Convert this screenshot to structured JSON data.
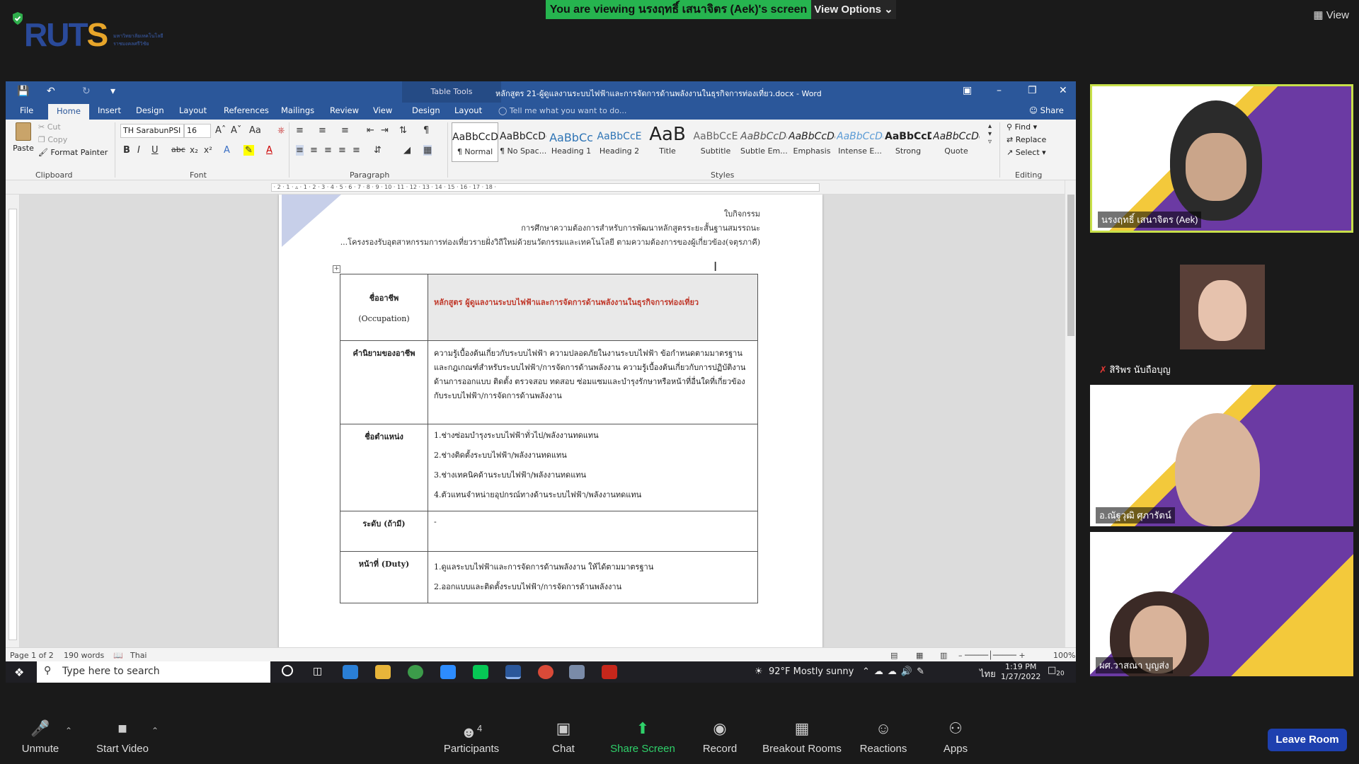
{
  "zoom": {
    "banner": "You are viewing นรงฤทธิ์ เสนาจิตร (Aek)'s screen",
    "view_options": "View Options ⌄",
    "view_top": "View",
    "logo": {
      "text_main": "RUT",
      "text_accent": "S",
      "sub": "มหาวิทยาลัยเทคโนโลยีราชมงคลศรีวิชัย"
    },
    "toolbar": {
      "unmute": "Unmute",
      "start_video": "Start Video",
      "participants": "Participants",
      "participants_count": "4",
      "chat": "Chat",
      "share_screen": "Share Screen",
      "record": "Record",
      "breakout_rooms": "Breakout Rooms",
      "reactions": "Reactions",
      "apps": "Apps",
      "leave": "Leave Room"
    },
    "participants": [
      {
        "name": "นรงฤทธิ์ เสนาจิตร (Aek)"
      },
      {
        "name": "สิริพร นับถือบุญ"
      },
      {
        "name": "อ.ณัฐวุฒิ ศุภารัตน์"
      },
      {
        "name": "ผศ.วาสณา บุญส่ง"
      }
    ],
    "colors": {
      "banner_green": "#26b44f",
      "leave_blue": "#1e40af",
      "word_blue": "#2b579a"
    }
  },
  "word": {
    "table_tools": "Table Tools",
    "title": "หลักสูตร 21-ผู้ดูแลงานระบบไฟฟ้าและการจัดการด้านพลังงานในธุรกิจการท่องเที่ยว.docx - Word",
    "tabs": [
      "File",
      "Home",
      "Insert",
      "Design",
      "Layout",
      "References",
      "Mailings",
      "Review",
      "View",
      "Design",
      "Layout"
    ],
    "tell_me": "Tell me what you want to do...",
    "share": "Share",
    "clipboard": {
      "paste": "Paste",
      "cut": "Cut",
      "copy": "Copy",
      "format_painter": "Format Painter",
      "label": "Clipboard"
    },
    "font": {
      "name": "TH SarabunPSI",
      "size": "16",
      "label": "Font"
    },
    "paragraph_label": "Paragraph",
    "styles_label": "Styles",
    "styles": [
      {
        "preview": "AaBbCcDc",
        "name": "¶ Normal"
      },
      {
        "preview": "AaBbCcDc",
        "name": "¶ No Spac..."
      },
      {
        "preview": "AaBbCс",
        "name": "Heading 1"
      },
      {
        "preview": "AaBbCcE",
        "name": "Heading 2"
      },
      {
        "preview": "AaB",
        "name": "Title"
      },
      {
        "preview": "AaBbCcE",
        "name": "Subtitle"
      },
      {
        "preview": "AaBbCcDc",
        "name": "Subtle Em..."
      },
      {
        "preview": "AaBbCcDc",
        "name": "Emphasis"
      },
      {
        "preview": "AaBbCcDc",
        "name": "Intense E..."
      },
      {
        "preview": "AaBbCcDc",
        "name": "Strong"
      },
      {
        "preview": "AaBbCcDc",
        "name": "Quote"
      }
    ],
    "editing": {
      "find": "Find",
      "replace": "Replace",
      "select": "Select",
      "label": "Editing"
    },
    "status": {
      "page": "Page 1 of 2",
      "words": "190 words",
      "lang": "Thai",
      "zoom": "100%"
    },
    "doc": {
      "header_line1": "ใบกิจกรรม",
      "header_line2": "การศึกษาความต้องการสำหรับการพัฒนาหลักสูตรระยะสั้นฐานสมรรถนะ",
      "header_line3": "...โครงรองรับอุตสาหกรรมการท่องเที่ยวรายฝั่งวิถีใหม่ด้วยนวัตกรรมและเทคโนโลยี ตามความต้องการของผู้เกี่ยวข้อง(จตุรภาคี)",
      "occupation_label": "ชื่ออาชีพ",
      "occupation_label_en": "(Occupation)",
      "occupation_value": "หลักสูตร ผู้ดูแลงานระบบไฟฟ้าและการจัดการด้านพลังงานในธุรกิจการท่องเที่ยว",
      "definition_label": "คำนิยามของอาชีพ",
      "definition_value": "ความรู้เบื้องต้นเกี่ยวกับระบบไฟฟ้า ความปลอดภัยในงานระบบไฟฟ้า ข้อกำหนดตามมาตรฐานและกฎเกณฑ์สำหรับระบบไฟฟ้า/การจัดการด้านพลังงาน ความรู้เบื้องต้นเกี่ยวกับการปฏิบัติงานด้านการออกแบบ ติดตั้ง ตรวจสอบ ทดสอบ ซ่อมแซมและบำรุงรักษาหรือหน้าที่อื่นใดที่เกี่ยวข้องกับระบบไฟฟ้า/การจัดการด้านพลังงาน",
      "position_label": "ชื่อตำแหน่ง",
      "positions": [
        "1.ช่างซ่อมบำรุงระบบไฟฟ้าทั่วไป/พลังงานทดแทน",
        "2.ช่างติดตั้งระบบไฟฟ้า/พลังงานทดแทน",
        "3.ช่างเทคนิคด้านระบบไฟฟ้า/พลังงานทดแทน",
        "4.ตัวแทนจำหน่ายอุปกรณ์ทางด้านระบบไฟฟ้า/พลังงานทดแทน"
      ],
      "level_label": "ระดับ (ถ้ามี)",
      "level_value": "-",
      "duty_label": "หน้าที่ (Duty)",
      "duty_value": "1.ดูแลระบบไฟฟ้าและการจัดการด้านพลังงาน ให้ได้ตามมาตรฐาน",
      "duty_value_2": "2.ออกแบบและติดตั้งระบบไฟฟ้า/การจัดการด้านพลังงาน"
    }
  },
  "taskbar": {
    "search_placeholder": "Type here to search",
    "weather": "92°F  Mostly sunny",
    "lang": "ไทย",
    "time": "1:19 PM",
    "date": "1/27/2022",
    "notifications": "20"
  }
}
